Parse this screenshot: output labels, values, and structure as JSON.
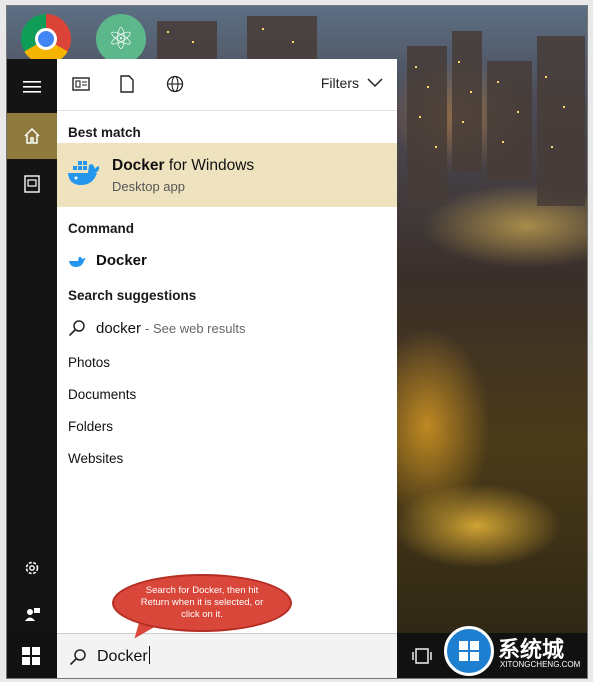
{
  "desktop": {
    "icons": [
      {
        "name": "chrome-icon"
      },
      {
        "name": "atom-icon",
        "glyph": "⚛"
      }
    ]
  },
  "rail": {
    "items": [
      {
        "name": "hamburger-icon"
      },
      {
        "name": "home-icon",
        "active": true
      },
      {
        "name": "documents-icon"
      },
      {
        "name": "settings-gear-icon"
      },
      {
        "name": "user-feedback-icon"
      }
    ]
  },
  "toolbar": {
    "filters_label": "Filters",
    "icons": [
      "apps-icon",
      "document-icon",
      "web-globe-icon",
      "chevron-down-icon"
    ]
  },
  "sections": {
    "best_match": "Best match",
    "command": "Command",
    "suggestions": "Search suggestions"
  },
  "best_result": {
    "title_bold": "Docker",
    "title_rest": " for Windows",
    "subtitle": "Desktop app",
    "icon": "docker-whale-icon"
  },
  "command_result": {
    "label": "Docker",
    "icon": "docker-small-icon"
  },
  "suggestion": {
    "term": "docker",
    "hint": "- See web results",
    "icon": "search-icon"
  },
  "categories": [
    "Photos",
    "Documents",
    "Folders",
    "Websites"
  ],
  "search": {
    "query": "Docker"
  },
  "callout": {
    "text": "Search for Docker, then hit Return when it is selected, or click on it."
  },
  "watermark": {
    "text": "系统城",
    "sub": "XITONGCHENG.COM"
  },
  "colors": {
    "accent": "#8d7a3c",
    "selection": "#efe3bf",
    "callout": "#d9463a"
  }
}
